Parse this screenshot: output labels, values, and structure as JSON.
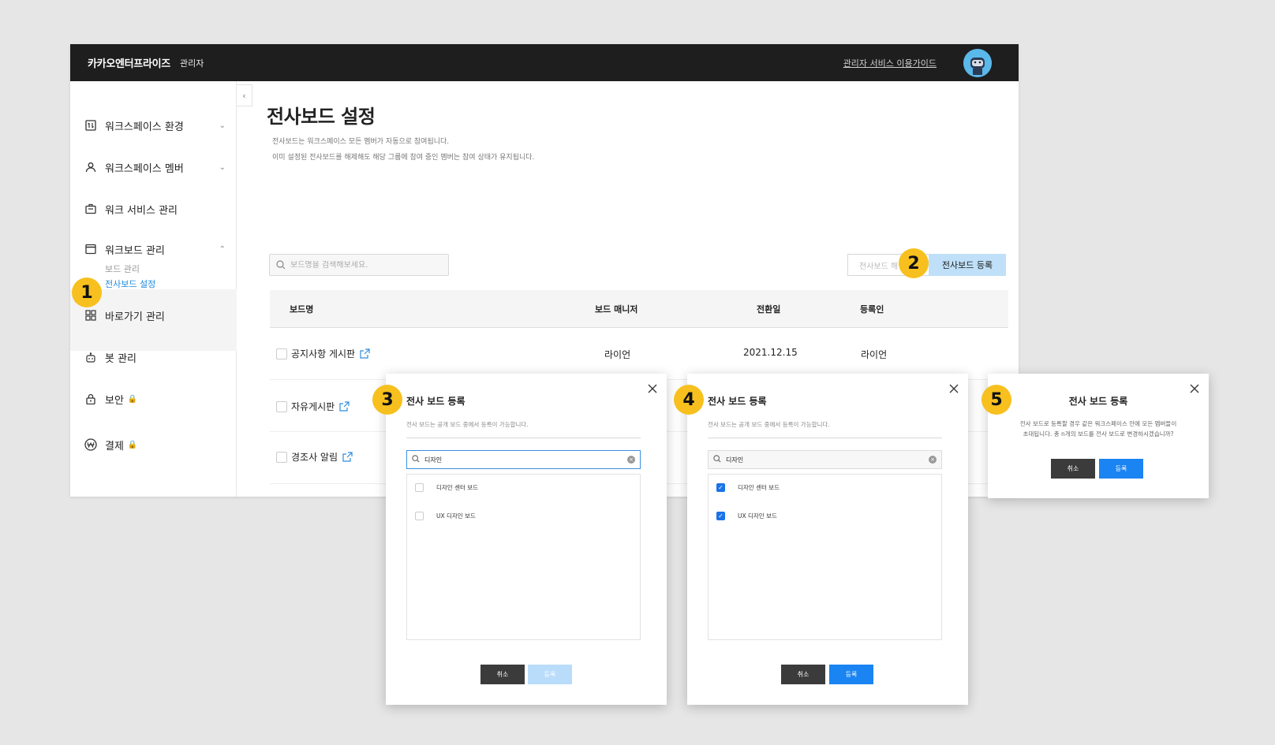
{
  "header": {
    "brand": "카카오엔터프라이즈",
    "brand_sub": "관리자",
    "guide_link": "관리자 서비스 이용가이드"
  },
  "sidebar": {
    "items": [
      {
        "label": "워크스페이스 환경"
      },
      {
        "label": "워크스페이스 멤버"
      },
      {
        "label": "워크 서비스 관리"
      },
      {
        "label": "워크보드 관리"
      },
      {
        "label": "바로가기 관리"
      },
      {
        "label": "봇 관리"
      },
      {
        "label": "보안"
      },
      {
        "label": "결제"
      }
    ],
    "sub_items": [
      {
        "label": "보드 관리"
      },
      {
        "label": "전사보드 설정"
      }
    ]
  },
  "main": {
    "title": "전사보드 설정",
    "desc1": "전사보드는 워크스페이스 모든 멤버가 자동으로 참여됩니다.",
    "desc2": "이미 설정된 전사보드를 해제해도 해당 그룹에 참여 중인 멤버는 참여 상태가 유지됩니다.",
    "search_placeholder": "보드명을 검색해보세요.",
    "btn_secondary": "전사보드 해",
    "btn_register": "전사보드 등록",
    "table": {
      "headers": [
        "보드명",
        "보드 매니저",
        "전환일",
        "등록인"
      ],
      "rows": [
        {
          "name": "공지사항 게시판",
          "manager": "라이언",
          "date": "2021.12.15",
          "registrant": "라이언"
        },
        {
          "name": "자유게시판"
        },
        {
          "name": "경조사 알림"
        }
      ]
    }
  },
  "dialog3": {
    "title": "전사 보드 등록",
    "subtitle": "전사 보드는 공개 보드 중에서 등록이 가능합니다.",
    "search_value": "디자인",
    "items": [
      {
        "label": "디자인 센터 보드",
        "checked": false
      },
      {
        "label": "UX 디자인 보드",
        "checked": false
      }
    ],
    "cancel": "취소",
    "confirm": "등록"
  },
  "dialog4": {
    "title": "전사 보드 등록",
    "subtitle": "전사 보드는 공개 보드 중에서 등록이 가능합니다.",
    "search_value": "디자인",
    "items": [
      {
        "label": "디자인 센터 보드",
        "checked": true
      },
      {
        "label": "UX 디자인 보드",
        "checked": true
      }
    ],
    "cancel": "취소",
    "confirm": "등록"
  },
  "dialog5": {
    "title": "전사 보드 등록",
    "message1": "전사 보드로 등록할 경우 같은 워크스페이스 안에 모든 멤버들이",
    "message2": "초대됩니다. 총 n개의 보드를 전사 보드로 변경하시겠습니까?",
    "cancel": "취소",
    "confirm": "등록"
  },
  "badges": [
    "1",
    "2",
    "3",
    "4",
    "5"
  ],
  "colors": {
    "accent": "#1a84f2",
    "badge": "#f7c01e",
    "topbar": "#1e1e1e",
    "active_link": "#1e8ae0"
  }
}
